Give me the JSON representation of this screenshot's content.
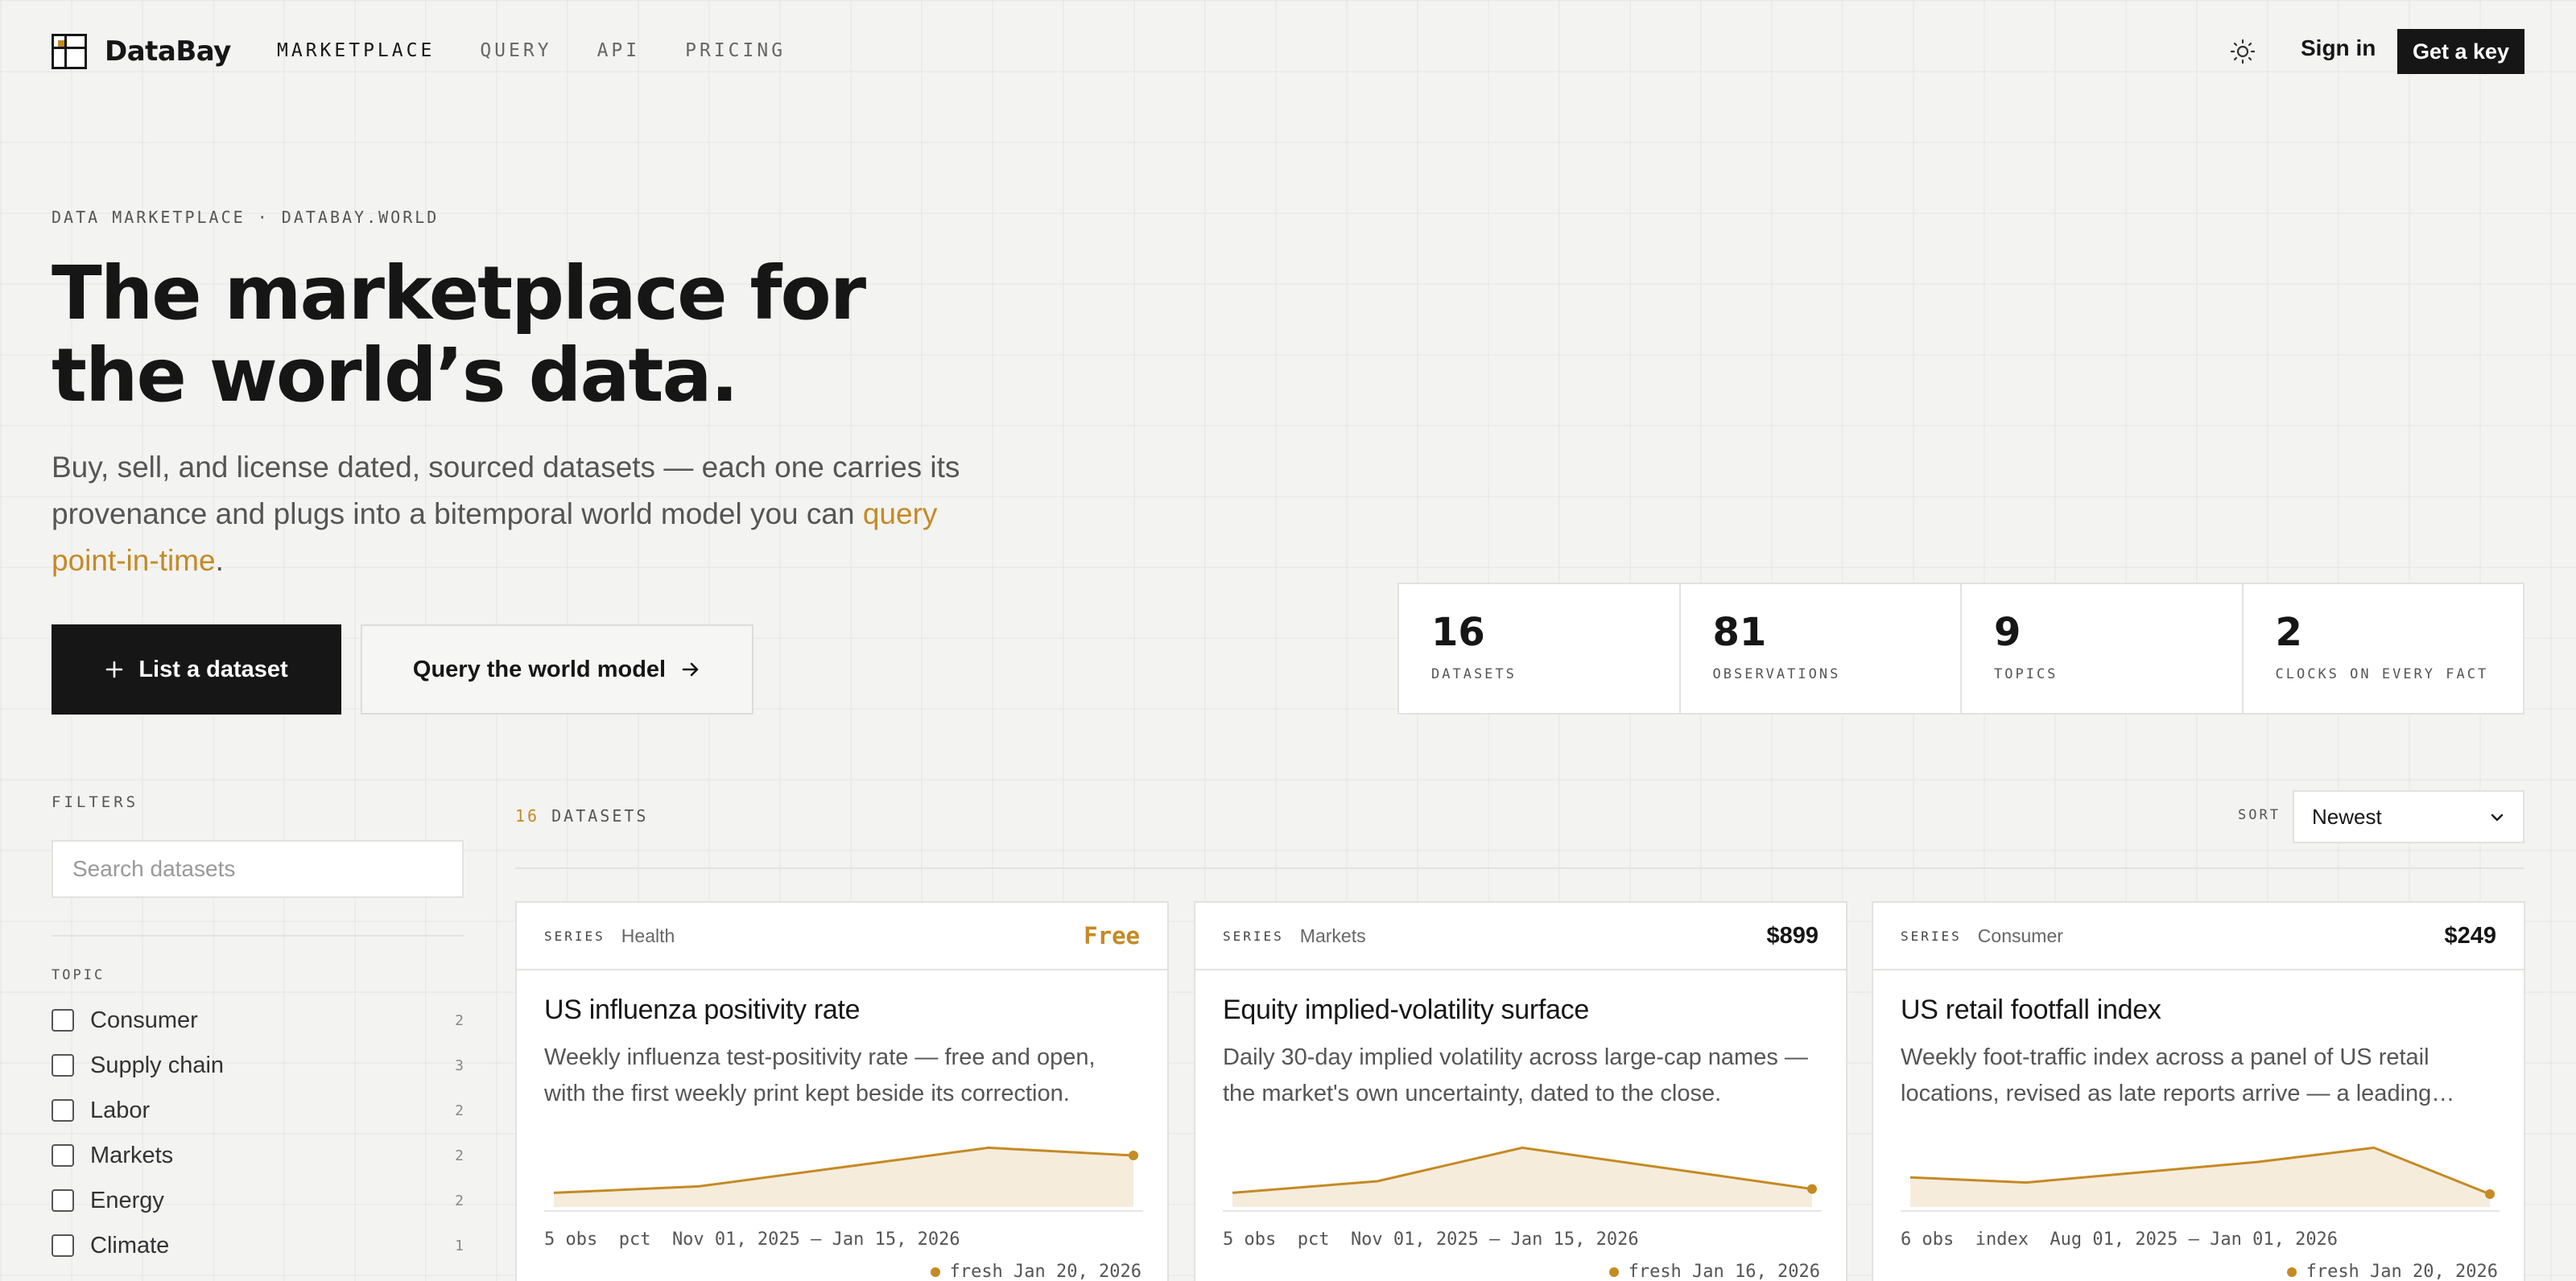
{
  "brand": {
    "name": "DataBay"
  },
  "nav": {
    "links": [
      "MARKETPLACE",
      "QUERY",
      "API",
      "PRICING"
    ],
    "active": "MARKETPLACE",
    "signin_label": "Sign in",
    "getkey_label": "Get a key",
    "theme_icon": "sun-icon"
  },
  "hero": {
    "eyebrow": "DATA MARKETPLACE · DATABAY.WORLD",
    "headline_line1": "The marketplace for",
    "headline_line2": "the world’s data.",
    "subhead_text": "Buy, sell, and license dated, sourced datasets — each one carries its provenance and plugs into a bitemporal world model you can ",
    "subhead_link": "query point-in-time",
    "subhead_end": ".",
    "primary_label": "List a dataset",
    "secondary_label": "Query the world model"
  },
  "stats": [
    {
      "value": "16",
      "label": "DATASETS"
    },
    {
      "value": "81",
      "label": "OBSERVATIONS"
    },
    {
      "value": "9",
      "label": "TOPICS"
    },
    {
      "value": "2",
      "label": "CLOCKS ON EVERY FACT"
    }
  ],
  "sidebar": {
    "title": "FILTERS",
    "search_placeholder": "Search datasets",
    "topic_title": "TOPIC",
    "topics": [
      {
        "label": "Consumer",
        "count": "2"
      },
      {
        "label": "Supply chain",
        "count": "3"
      },
      {
        "label": "Labor",
        "count": "2"
      },
      {
        "label": "Markets",
        "count": "2"
      },
      {
        "label": "Energy",
        "count": "2"
      },
      {
        "label": "Climate",
        "count": "1"
      }
    ]
  },
  "listing": {
    "count": "16",
    "count_label": "DATASETS",
    "sort_label": "SORT",
    "sort_value": "Newest"
  },
  "colors": {
    "accent": "#c58a24",
    "ink": "#161616",
    "spark_fill": "#f6ecdc"
  },
  "cards": [
    {
      "kind": "SERIES",
      "topic": "Health",
      "price": "Free",
      "is_free": true,
      "title": "US influenza positivity rate",
      "desc": "Weekly influenza test-positivity rate — free and open, with the first weekly print kept beside its correction.",
      "meta": "5 obs  pct  Nov 01, 2025 – Jan 15, 2026",
      "fresh": "fresh Jan 20, 2026",
      "spark": [
        0.22,
        0.32,
        0.62,
        0.92,
        0.8
      ]
    },
    {
      "kind": "SERIES",
      "topic": "Markets",
      "price": "$899",
      "is_free": false,
      "title": "Equity implied-volatility surface",
      "desc": "Daily 30-day implied volatility across large-cap names — the market's own uncertainty, dated to the close.",
      "meta": "5 obs  pct  Nov 01, 2025 – Jan 15, 2026",
      "fresh": "fresh Jan 16, 2026",
      "spark": [
        0.22,
        0.4,
        0.92,
        0.6,
        0.28
      ]
    },
    {
      "kind": "SERIES",
      "topic": "Consumer",
      "price": "$249",
      "is_free": false,
      "title": "US retail footfall index",
      "desc": "Weekly foot-traffic index across a panel of US retail locations, revised as late reports arrive — a leading…",
      "meta": "6 obs  index  Aug 01, 2025 – Jan 01, 2026",
      "fresh": "fresh Jan 20, 2026",
      "spark": [
        0.46,
        0.38,
        0.54,
        0.7,
        0.92,
        0.2
      ]
    }
  ]
}
